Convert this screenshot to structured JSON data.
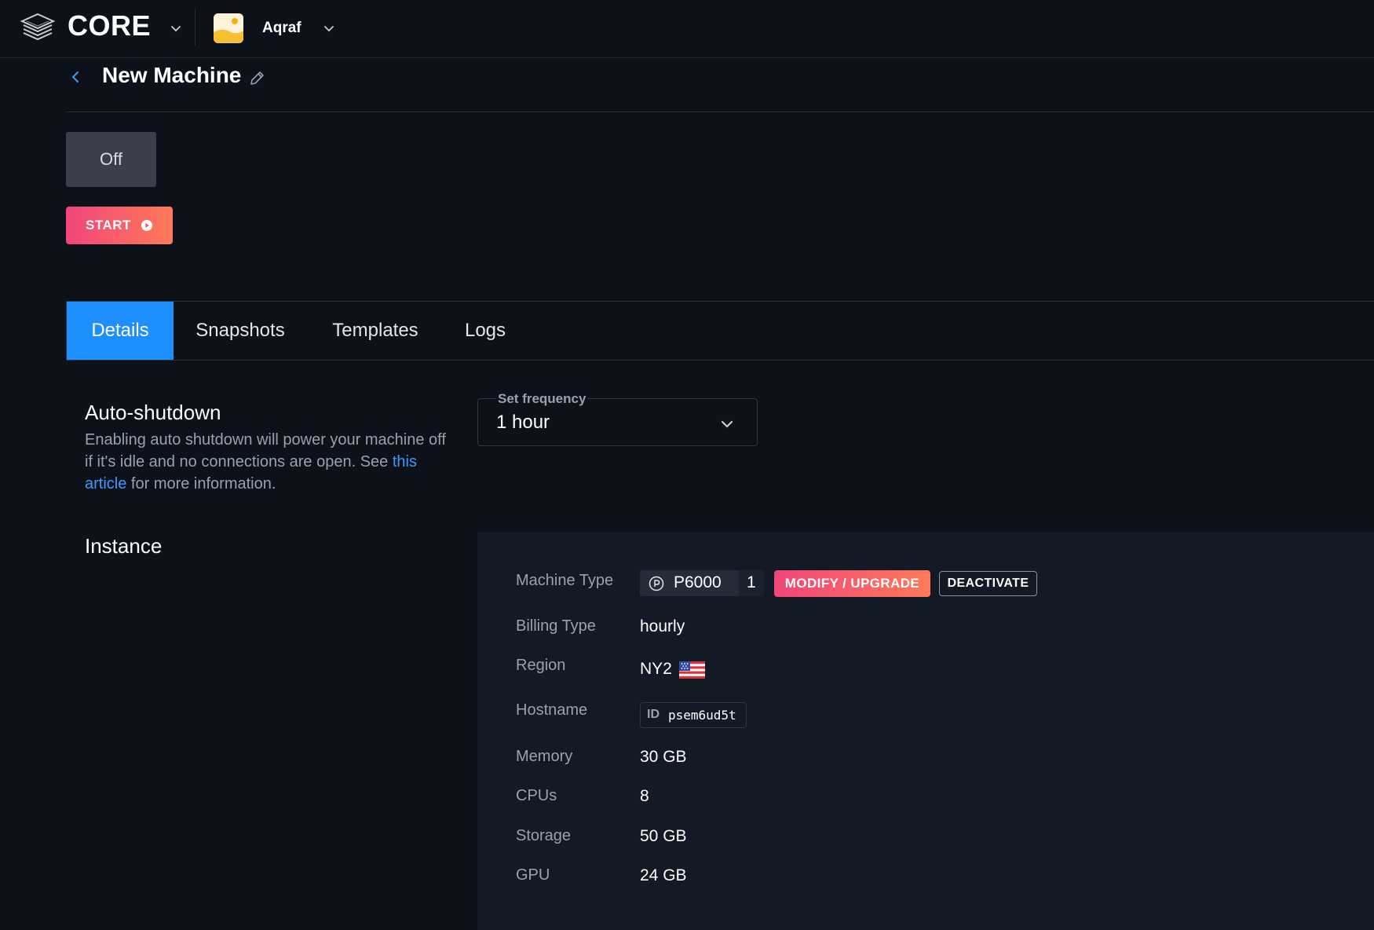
{
  "app": {
    "brand": "CORE",
    "team_name": "Aqraf"
  },
  "page": {
    "title": "New Machine"
  },
  "machine_state": {
    "status": "Off",
    "start_label": "START"
  },
  "tabs": [
    {
      "label": "Details",
      "active": true
    },
    {
      "label": "Snapshots",
      "active": false
    },
    {
      "label": "Templates",
      "active": false
    },
    {
      "label": "Logs",
      "active": false
    }
  ],
  "auto_shutdown": {
    "title": "Auto-shutdown",
    "desc_before": "Enabling auto shutdown will power your machine off if it's idle and no connections are open. See ",
    "link_text": "this article",
    "desc_after": " for more information.",
    "frequency_label": "Set frequency",
    "frequency_value": "1 hour"
  },
  "instance": {
    "title": "Instance",
    "machine_type_label": "Machine Type",
    "machine_type": "P6000",
    "machine_count": "1",
    "modify_label": "MODIFY / UPGRADE",
    "deactivate_label": "DEACTIVATE",
    "billing_label": "Billing Type",
    "billing_value": "hourly",
    "region_label": "Region",
    "region_value": "NY2",
    "hostname_label": "Hostname",
    "hostname_prefix": "ID",
    "hostname_value": "psem6ud5t",
    "memory_label": "Memory",
    "memory_value": "30 GB",
    "cpus_label": "CPUs",
    "cpus_value": "8",
    "storage_label": "Storage",
    "storage_value": "50 GB",
    "gpu_label": "GPU",
    "gpu_value": "24 GB"
  },
  "colors": {
    "background": "#0d111a",
    "panel": "#141a25",
    "accent_blue": "#1e8fff",
    "gradient_start": "#f0457a",
    "gradient_end": "#ff7a59",
    "muted_text": "#9aa1ad"
  },
  "icons": {
    "logo": "stacked-layers-icon",
    "team_chevron": "chevron-down-icon",
    "back": "chevron-left-icon",
    "edit": "pencil-icon",
    "start": "play-circle-icon",
    "select": "chevron-down-icon",
    "machine_type": "p-circle-icon",
    "region": "us-flag-icon"
  }
}
